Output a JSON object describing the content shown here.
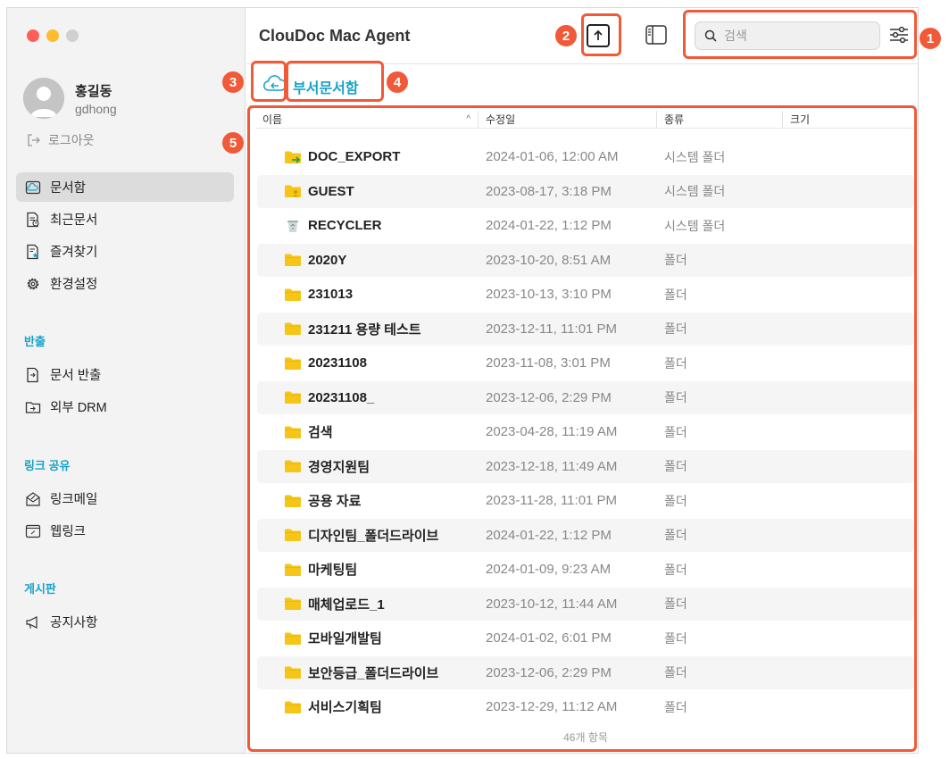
{
  "window": {
    "title": "ClouDoc Mac Agent"
  },
  "colors": {
    "accent": "#17a2c8",
    "annotation": "#f05a38",
    "folder": "#f5c518"
  },
  "user": {
    "name": "홍길동",
    "id": "gdhong",
    "logout_label": "로그아웃"
  },
  "nav": [
    {
      "label": "문서함",
      "icon": "cloud-doc-icon",
      "active": true
    },
    {
      "label": "최근문서",
      "icon": "recent-doc-icon",
      "active": false
    },
    {
      "label": "즐겨찾기",
      "icon": "favorite-doc-icon",
      "active": false
    },
    {
      "label": "환경설정",
      "icon": "gear-icon",
      "active": false
    }
  ],
  "sections": {
    "export": {
      "title": "반출",
      "items": [
        "문서 반출",
        "외부 DRM"
      ]
    },
    "link": {
      "title": "링크 공유",
      "items": [
        "링크메일",
        "웹링크"
      ]
    },
    "board": {
      "title": "게시판",
      "items": [
        "공지사항"
      ]
    }
  },
  "search": {
    "placeholder": "검색",
    "value": ""
  },
  "breadcrumb": "부서문서함",
  "table": {
    "columns": [
      "이름",
      "수정일",
      "종류",
      "크기"
    ],
    "sort_indicator": "^",
    "rows": [
      {
        "name": "DOC_EXPORT",
        "date": "2024-01-06, 12:00 AM",
        "kind": "시스템 폴더",
        "icon": "export-folder-icon"
      },
      {
        "name": "GUEST",
        "date": "2023-08-17, 3:18 PM",
        "kind": "시스템 폴더",
        "icon": "guest-folder-icon"
      },
      {
        "name": "RECYCLER",
        "date": "2024-01-22, 1:12 PM",
        "kind": "시스템 폴더",
        "icon": "recycle-bin-icon"
      },
      {
        "name": "2020Y",
        "date": "2023-10-20, 8:51 AM",
        "kind": "폴더",
        "icon": "folder-icon"
      },
      {
        "name": "231013",
        "date": "2023-10-13, 3:10 PM",
        "kind": "폴더",
        "icon": "folder-icon"
      },
      {
        "name": "231211 용량 테스트",
        "date": "2023-12-11, 11:01 PM",
        "kind": "폴더",
        "icon": "folder-icon"
      },
      {
        "name": "20231108",
        "date": "2023-11-08, 3:01 PM",
        "kind": "폴더",
        "icon": "folder-icon"
      },
      {
        "name": "20231108_",
        "date": "2023-12-06, 2:29 PM",
        "kind": "폴더",
        "icon": "folder-icon"
      },
      {
        "name": "검색",
        "date": "2023-04-28, 11:19 AM",
        "kind": "폴더",
        "icon": "folder-icon"
      },
      {
        "name": "경영지원팀",
        "date": "2023-12-18, 11:49 AM",
        "kind": "폴더",
        "icon": "folder-icon"
      },
      {
        "name": "공용 자료",
        "date": "2023-11-28, 11:01 PM",
        "kind": "폴더",
        "icon": "folder-icon"
      },
      {
        "name": "디자인팀_폴더드라이브",
        "date": "2024-01-22, 1:12 PM",
        "kind": "폴더",
        "icon": "folder-icon"
      },
      {
        "name": "마케팅팀",
        "date": "2024-01-09, 9:23 AM",
        "kind": "폴더",
        "icon": "folder-icon"
      },
      {
        "name": "매체업로드_1",
        "date": "2023-10-12, 11:44 AM",
        "kind": "폴더",
        "icon": "folder-icon"
      },
      {
        "name": "모바일개발팀",
        "date": "2024-01-02, 6:01 PM",
        "kind": "폴더",
        "icon": "folder-icon"
      },
      {
        "name": "보안등급_폴더드라이브",
        "date": "2023-12-06, 2:29 PM",
        "kind": "폴더",
        "icon": "folder-icon"
      },
      {
        "name": "서비스기획팀",
        "date": "2023-12-29, 11:12 AM",
        "kind": "폴더",
        "icon": "folder-icon"
      }
    ]
  },
  "footer": "46개 항목",
  "annotations": [
    "1",
    "2",
    "3",
    "4",
    "5"
  ]
}
